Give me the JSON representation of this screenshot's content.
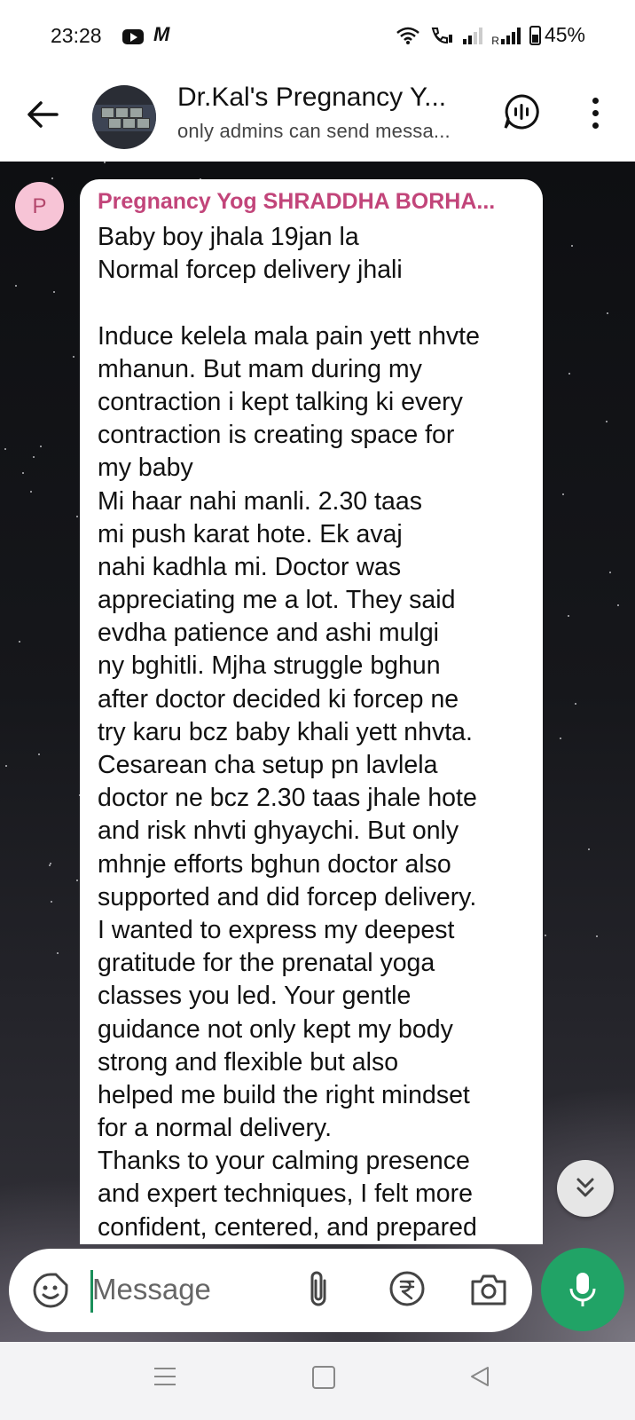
{
  "status_bar": {
    "time": "23:28",
    "gmail_glyph": "M",
    "sim1_label": "R",
    "battery": "45%"
  },
  "header": {
    "title": "Dr.Kal's Pregnancy Y...",
    "subtitle": "only admins can send messa..."
  },
  "message": {
    "avatar_letter": "P",
    "sender": "Pregnancy Yog SHRADDHA BORHA...",
    "lines": [
      "Baby boy jhala 19jan la",
      "Normal forcep delivery jhali",
      "",
      "Induce kelela mala pain yett nhvte",
      "mhanun. But mam during my",
      "contraction i kept talking ki every",
      "contraction is creating space for",
      "my baby",
      "Mi haar nahi manli. 2.30 taas",
      "mi push karat hote. Ek avaj",
      "nahi kadhla mi. Doctor was",
      "appreciating me a lot. They said",
      "evdha patience and ashi mulgi",
      "ny bghitli. Mjha struggle bghun",
      "after doctor decided ki forcep ne",
      "try karu bcz baby khali yett nhvta.",
      "Cesarean cha setup pn lavlela",
      "doctor ne bcz 2.30 taas jhale hote",
      "and risk nhvti ghyaychi. But only",
      "mhnje efforts bghun doctor also",
      "supported and did forcep delivery.",
      "I wanted to express my deepest",
      "gratitude for the prenatal yoga",
      "classes you led. Your gentle",
      "guidance not only kept my body",
      "strong and flexible but also",
      "helped me build the right mindset",
      "for a normal delivery.",
      "Thanks to your calming presence",
      "and expert techniques, I felt more",
      "confident, centered, and prepared"
    ]
  },
  "composer": {
    "placeholder": "Message"
  },
  "colors": {
    "accent": "#21a366",
    "sender_name": "#c2457a",
    "avatar_bg": "#f7c4d6"
  },
  "icons": [
    "back-arrow-icon",
    "voice-chat-icon",
    "more-options-icon",
    "emoji-sticker-icon",
    "attach-icon",
    "rupee-payment-icon",
    "camera-icon",
    "mic-icon",
    "scroll-down-icon"
  ]
}
